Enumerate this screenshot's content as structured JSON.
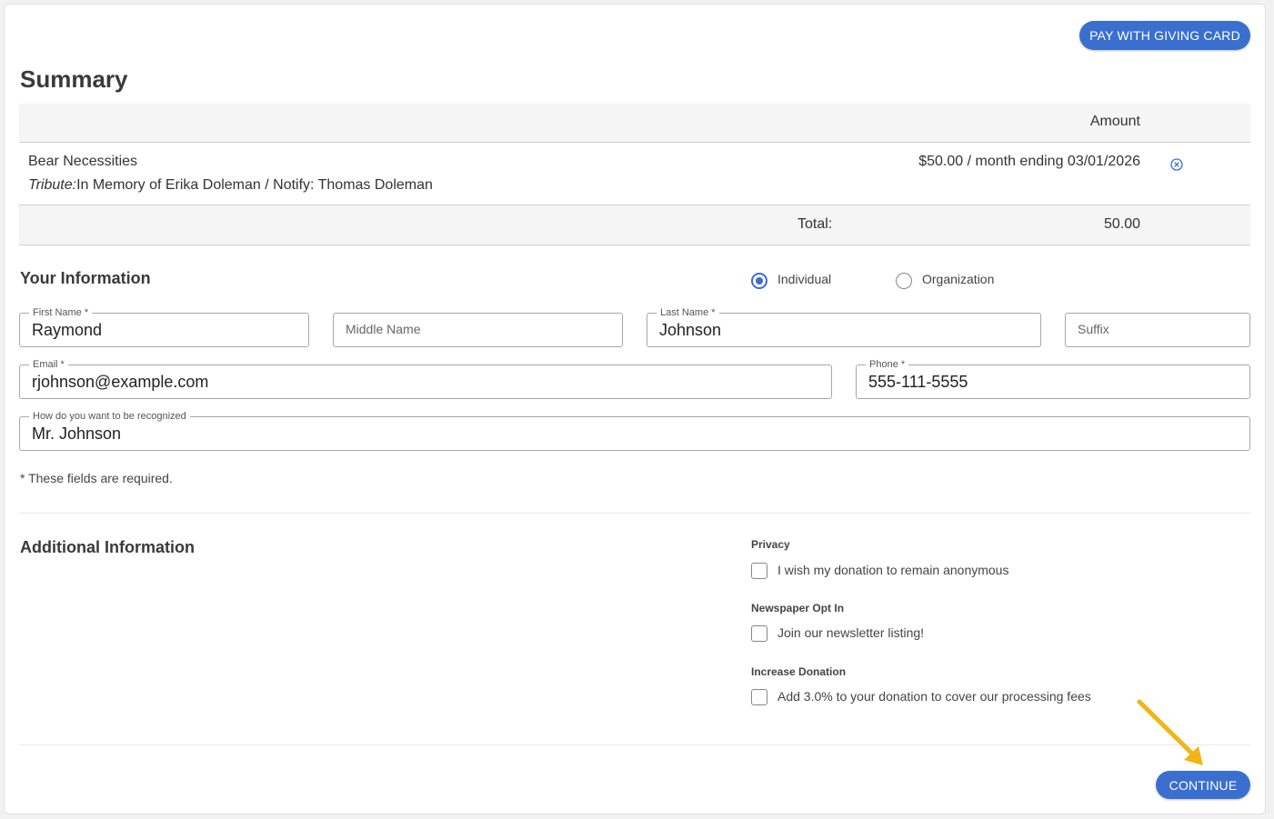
{
  "header": {
    "giving_card_button": "PAY WITH GIVING CARD"
  },
  "summary": {
    "title": "Summary",
    "amount_header": "Amount",
    "item": {
      "name": "Bear Necessities",
      "tribute_label": "Tribute:",
      "tribute_text": "In Memory of Erika Doleman / Notify: Thomas Doleman",
      "amount": "$50.00 / month ending 03/01/2026"
    },
    "total_label": "Total:",
    "total_value": "50.00"
  },
  "your_info": {
    "title": "Your Information",
    "type_options": [
      {
        "label": "Individual",
        "selected": true
      },
      {
        "label": "Organization",
        "selected": false
      }
    ],
    "first_name": {
      "label": "First Name *",
      "value": "Raymond"
    },
    "middle_name": {
      "placeholder": "Middle Name"
    },
    "last_name": {
      "label": "Last Name *",
      "value": "Johnson"
    },
    "suffix": {
      "placeholder": "Suffix"
    },
    "email": {
      "label": "Email *",
      "value": "rjohnson@example.com"
    },
    "phone": {
      "label": "Phone *",
      "value": "555-111-5555"
    },
    "recognition": {
      "label": "How do you want to be recognized",
      "value": "Mr. Johnson"
    },
    "required_note": "* These fields are required."
  },
  "additional_info": {
    "title": "Additional Information",
    "groups": [
      {
        "heading": "Privacy",
        "option": "I wish my donation to remain anonymous",
        "checked": false
      },
      {
        "heading": "Newspaper Opt In",
        "option": "Join our newsletter listing!",
        "checked": false
      },
      {
        "heading": "Increase Donation",
        "option": "Add 3.0% to your donation to cover our processing fees",
        "checked": false
      }
    ]
  },
  "footer": {
    "continue_button": "CONTINUE"
  },
  "colors": {
    "accent": "#3a6fd0",
    "arrow": "#f2b517"
  }
}
